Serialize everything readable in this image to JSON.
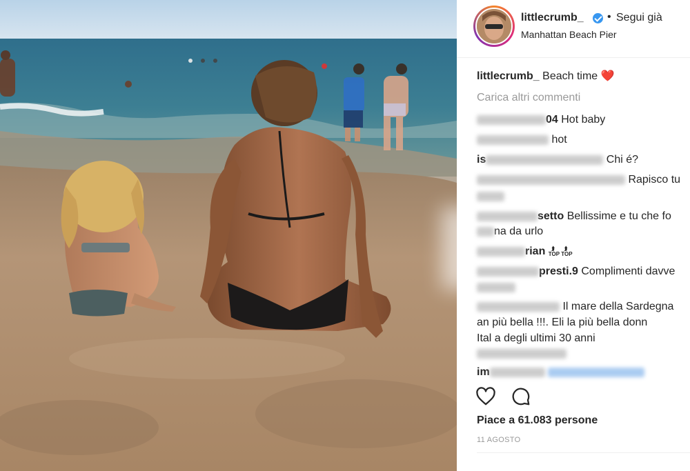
{
  "post": {
    "username": "littlecrumb_",
    "follow_label": "Segui già",
    "location": "Manhattan Beach Pier",
    "caption_user": "littlecrumb_",
    "caption_text": "Beach time ❤️",
    "load_more": "Carica altri commenti",
    "likes": "Piace a 61.083 persone",
    "date": "11 AGOSTO"
  },
  "comments": [
    {
      "user_suffix": "04",
      "text": "Hot baby"
    },
    {
      "user_suffix": "",
      "text": "hot"
    },
    {
      "user_suffix": "is",
      "text": "Chi é?"
    },
    {
      "user_suffix": "",
      "text": "Rapisco tu"
    },
    {
      "user_suffix": "setto",
      "text": "Bellissime e tu che fo"
    },
    {
      "user_suffix": "",
      "text": "na da urlo"
    },
    {
      "user_suffix": "rian",
      "text": ""
    },
    {
      "user_suffix": "presti.9",
      "text": "Complimenti davve"
    },
    {
      "user_suffix": "",
      "text": "Il mare della Sardegna"
    },
    {
      "user_suffix": "",
      "text": "an   più bella !!!. Eli la più bella donn"
    },
    {
      "user_suffix": "",
      "text": "Ital   a degli ultimi 30 anni"
    },
    {
      "user_suffix": "im",
      "text": "."
    }
  ],
  "badges": {
    "top": "TOP"
  },
  "icons": {
    "verified": "verified-badge-icon",
    "like": "heart-icon",
    "comment": "comment-bubble-icon"
  },
  "colors": {
    "accent": "#3897f0",
    "text": "#262626",
    "muted": "#999999"
  }
}
